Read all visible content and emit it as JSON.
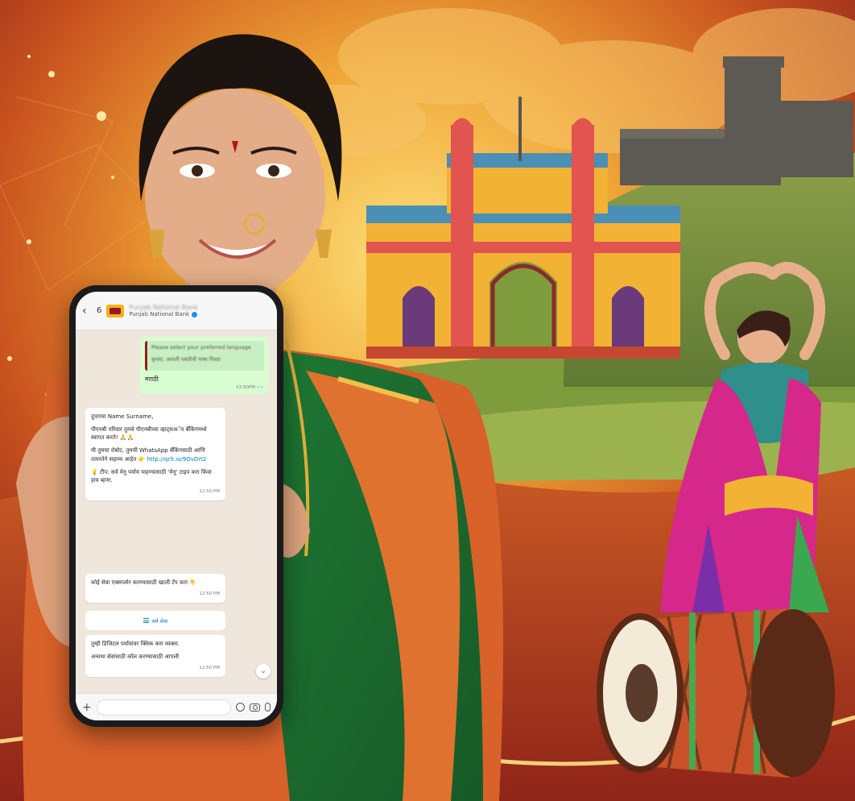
{
  "scene": {
    "description_icons": [
      "woman-portrait",
      "gateway-of-india-illustration",
      "hill-fort-illustration",
      "lavani-dancer-illustration",
      "dhol-drum-illustration"
    ],
    "colors": {
      "background_red": "#8a1f1a",
      "glow_orange": "#f0a636",
      "saree_green": "#1f6b2c",
      "saree_border": "#d8622a",
      "monument_yellow": "#f2b233"
    }
  },
  "phone": {
    "header": {
      "back_icon": "‹",
      "unread_count": "6",
      "contact_name": "Punjab National Bank",
      "contact_subtitle": "Punjab National Bank"
    },
    "messages": {
      "outgoing": {
        "quote_line1": "Please select your preferred language",
        "quote_line2": "कृपया, आपली पसंतीची भाषा निवडा",
        "reply": "मराठी",
        "time": "12:50PM ✓✓"
      },
      "welcome": {
        "greeting": "दुपारचा Name Surname,",
        "line1": "पीएनबी परिवार तुमचे पीएनबीच्या व्हाट्सअॅप बँकिंगमध्ये स्वागत करते! 🙏🙏",
        "line2": "मी तुमचा रोबोट, तुमची WhatsApp बँकिंगसाठी आणि तत्परतेने सहाय्य आहेत 👉",
        "link": "http://qrlt.io/9OvDrt2",
        "line3": "💡 टीप: सर्व मेनू पर्याय पाहण्यासाठी 'मेनू' टाइप करा किंवा हाय म्हणा.",
        "time": "12:50 PM"
      },
      "prompt": {
        "text": "कोई सेवा एक्सप्लोर करण्यासाठी खाली टॅप करा 👇",
        "time": "12:50 PM"
      },
      "action": {
        "label": "सर्व सेवा"
      },
      "last": {
        "line1": "तुम्ही डिजिटल पर्यायांवर क्लिक करा व्यक्ता.",
        "line2": "अन्यथा सेवांसाठी कॉल करण्यासाठी आपली",
        "time": "12:50 PM"
      }
    },
    "input": {
      "placeholder": ""
    }
  }
}
